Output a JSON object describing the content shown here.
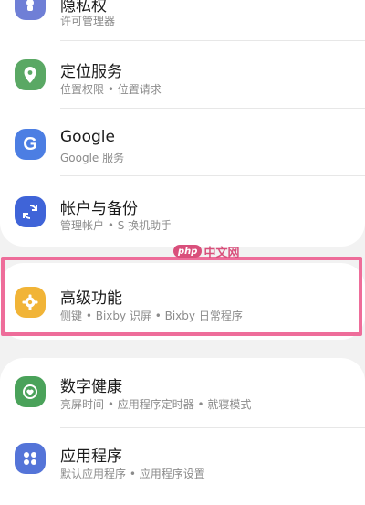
{
  "settings": [
    {
      "title": "隐私权",
      "subtitle": "许可管理器",
      "icon": "privacy-icon",
      "color": "#6f7fd6"
    },
    {
      "title": "定位服务",
      "subtitle": "位置权限 • 位置请求",
      "icon": "location-icon",
      "color": "#5aa864"
    },
    {
      "title": "Google",
      "subtitle": "Google 服务",
      "icon": "google-icon",
      "color": "#4c7ee3"
    },
    {
      "title": "帐户与备份",
      "subtitle": "管理帐户 • S 换机助手",
      "icon": "sync-icon",
      "color": "#3f64d8"
    },
    {
      "title": "高级功能",
      "subtitle": "侧键 • Bixby 识屏 • Bixby 日常程序",
      "icon": "gear-icon",
      "color": "#f1b437"
    },
    {
      "title": "数字健康",
      "subtitle": "亮屏时间 • 应用程序定时器 • 就寝模式",
      "icon": "wellbeing-icon",
      "color": "#4aa25a"
    },
    {
      "title": "应用程序",
      "subtitle": "默认应用程序 • 应用程序设置",
      "icon": "apps-icon",
      "color": "#5474d8"
    }
  ],
  "watermark": {
    "logo": "php",
    "text": "中文网"
  }
}
